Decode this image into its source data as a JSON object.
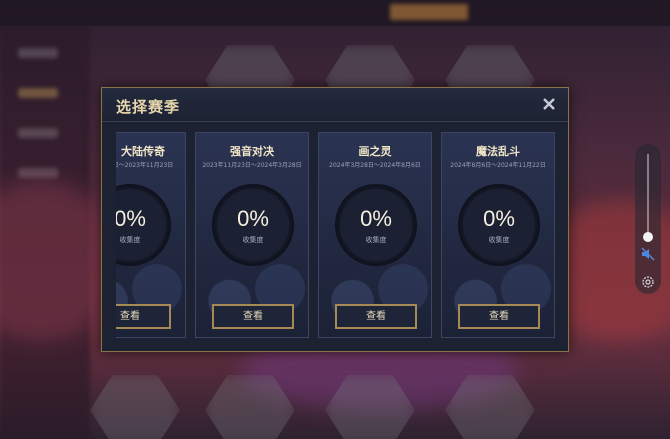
{
  "modal": {
    "title": "选择赛季",
    "close_icon": "close-icon"
  },
  "seasons": [
    {
      "name": "大陆传奇",
      "dates": "日～2023年11月23日",
      "progress": "0%",
      "progress_label": "收集度",
      "button": "查看"
    },
    {
      "name": "强音对决",
      "dates": "2023年11月23日～2024年3月28日",
      "progress": "0%",
      "progress_label": "收集度",
      "button": "查看"
    },
    {
      "name": "画之灵",
      "dates": "2024年3月28日～2024年8月6日",
      "progress": "0%",
      "progress_label": "收集度",
      "button": "查看"
    },
    {
      "name": "魔法乱斗",
      "dates": "2024年8月6日～2024年11月22日",
      "progress": "0%",
      "progress_label": "收集度",
      "button": "查看"
    }
  ],
  "volume_widget": {
    "level": 0.0,
    "mute_icon": "speaker-muted-icon",
    "settings_icon": "gear-icon"
  },
  "colors": {
    "modal_bg": "#1d2233",
    "modal_border": "#8a7447",
    "title_gold": "#e6d6ac",
    "button_border": "#a68a55"
  }
}
